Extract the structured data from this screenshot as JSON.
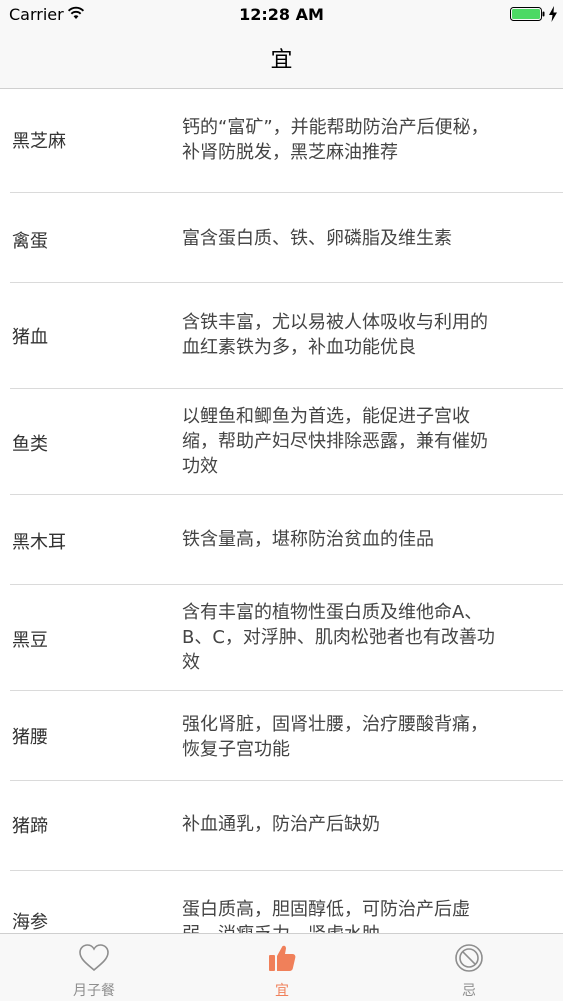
{
  "status_bar": {
    "carrier": "Carrier",
    "time": "12:28 AM"
  },
  "nav": {
    "title": "宜"
  },
  "items": [
    {
      "food": "黑芝麻",
      "lines": [
        "钙的“富矿”，并能帮助防治产后便秘，",
        "补肾防脱发，黑芝麻油推荐"
      ]
    },
    {
      "food": "禽蛋",
      "lines": [
        "富含蛋白质、铁、卵磷脂及维生素"
      ]
    },
    {
      "food": "猪血",
      "lines": [
        "含铁丰富，尤以易被人体吸收与利用的",
        "血红素铁为多，补血功能优良"
      ]
    },
    {
      "food": "鱼类",
      "lines": [
        "以鲤鱼和鲫鱼为首选，能促进子宫收",
        "缩，帮助产妇尽快排除恶露，兼有催奶",
        "功效"
      ]
    },
    {
      "food": "黑木耳",
      "lines": [
        "铁含量高，堪称防治贫血的佳品"
      ]
    },
    {
      "food": "黑豆",
      "lines": [
        "含有丰富的植物性蛋白质及维他命A、",
        "B、C，对浮肿、肌肉松弛者也有改善功",
        "效"
      ]
    },
    {
      "food": "猪腰",
      "lines": [
        "强化肾脏，固肾壮腰，治疗腰酸背痛，",
        "恢复子宫功能"
      ]
    },
    {
      "food": "猪蹄",
      "lines": [
        "补血通乳，防治产后缺奶"
      ]
    },
    {
      "food": "海参",
      "lines": [
        "蛋白质高，胆固醇低，可防治产后虚",
        "弱、消瘦乏力、肾虚水肿"
      ]
    }
  ],
  "tabs": [
    {
      "label": "月子餐",
      "icon": "heart-icon",
      "active": false
    },
    {
      "label": "宜",
      "icon": "thumbs-up-icon",
      "active": true
    },
    {
      "label": "忌",
      "icon": "prohibited-icon",
      "active": false
    }
  ],
  "colors": {
    "accent": "#f0805a",
    "inactive": "#8e8e8e",
    "battery": "#4cd964"
  }
}
